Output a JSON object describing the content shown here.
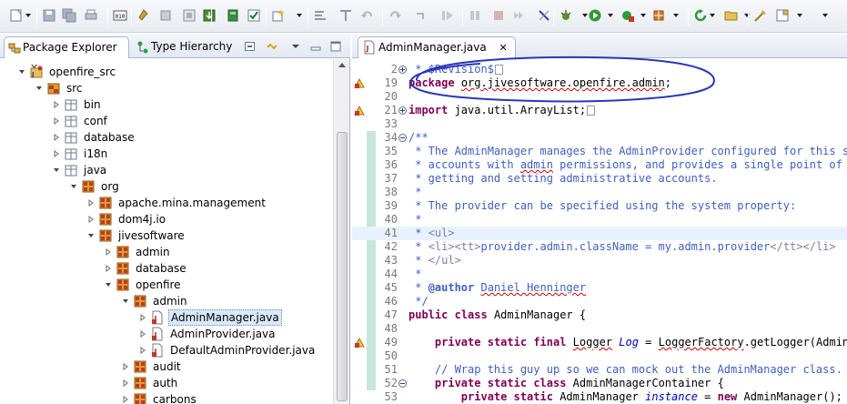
{
  "toolbar": {
    "icons": [
      "new-icon",
      "save-icon",
      "save-all-icon",
      "print-icon",
      "binary-icon",
      "pin-icon",
      "stop-icon",
      "console-icon",
      "download-icon",
      "battery-icon",
      "check-icon",
      "new-class-icon",
      "refactor-icon",
      "format-icon",
      "undo-icon",
      "redo-icon",
      "redo2-icon",
      "resume-icon",
      "suspend-icon",
      "terminate-icon",
      "step-icon",
      "skip-icon",
      "debug-icon",
      "run-icon",
      "run-config-icon",
      "build-icon",
      "refresh-icon",
      "open-folder-icon",
      "tools-icon",
      "perspective-icon"
    ]
  },
  "left_tabs": [
    {
      "label": "Package Explorer",
      "close": "✕"
    },
    {
      "label": "Type Hierarchy"
    }
  ],
  "tree": [
    {
      "label": "openfire_src",
      "depth": 0,
      "expanded": true,
      "icon": "project-icon"
    },
    {
      "label": "src",
      "depth": 1,
      "expanded": true,
      "icon": "source-folder-icon"
    },
    {
      "label": "bin",
      "depth": 2,
      "expanded": false,
      "icon": "folder-icon"
    },
    {
      "label": "conf",
      "depth": 2,
      "expanded": false,
      "icon": "folder-icon"
    },
    {
      "label": "database",
      "depth": 2,
      "expanded": false,
      "icon": "folder-icon"
    },
    {
      "label": "i18n",
      "depth": 2,
      "expanded": false,
      "icon": "folder-icon"
    },
    {
      "label": "java",
      "depth": 2,
      "expanded": true,
      "icon": "folder-icon"
    },
    {
      "label": "org",
      "depth": 3,
      "expanded": true,
      "icon": "package-icon"
    },
    {
      "label": "apache.mina.management",
      "depth": 4,
      "expanded": false,
      "icon": "package-icon"
    },
    {
      "label": "dom4j.io",
      "depth": 4,
      "expanded": false,
      "icon": "package-icon"
    },
    {
      "label": "jivesoftware",
      "depth": 4,
      "expanded": true,
      "icon": "package-icon"
    },
    {
      "label": "admin",
      "depth": 5,
      "expanded": false,
      "icon": "package-icon"
    },
    {
      "label": "database",
      "depth": 5,
      "expanded": false,
      "icon": "package-icon"
    },
    {
      "label": "openfire",
      "depth": 5,
      "expanded": true,
      "icon": "package-icon"
    },
    {
      "label": "admin",
      "depth": 6,
      "expanded": true,
      "icon": "package-icon"
    },
    {
      "label": "AdminManager.java",
      "depth": 7,
      "expanded": false,
      "icon": "java-file-icon",
      "selected": true
    },
    {
      "label": "AdminProvider.java",
      "depth": 7,
      "expanded": false,
      "icon": "java-file-icon"
    },
    {
      "label": "DefaultAdminProvider.java",
      "depth": 7,
      "expanded": false,
      "icon": "java-file-icon"
    },
    {
      "label": "audit",
      "depth": 6,
      "expanded": false,
      "icon": "package-icon"
    },
    {
      "label": "auth",
      "depth": 6,
      "expanded": false,
      "icon": "package-icon"
    },
    {
      "label": "carbons",
      "depth": 6,
      "expanded": false,
      "icon": "package-icon"
    }
  ],
  "editor": {
    "tab_label": "AdminManager.java",
    "tab_close": "✕",
    "lines": [
      {
        "num": "2",
        "fold": "plus",
        "marker": "",
        "segs": [
          [
            " * $Revision$",
            "cm"
          ],
          [
            "",
            "box"
          ]
        ]
      },
      {
        "num": "19",
        "fold": "",
        "marker": "warn",
        "segs": [
          [
            "package",
            "kw"
          ],
          [
            " ",
            ""
          ],
          [
            "org.jivesoftware.openfire.admin",
            "sq"
          ],
          [
            ";",
            ""
          ]
        ]
      },
      {
        "num": "20",
        "fold": "",
        "marker": "",
        "segs": []
      },
      {
        "num": "21",
        "fold": "plus",
        "marker": "warn",
        "segs": [
          [
            "import",
            "kw"
          ],
          [
            " java.util.ArrayList;",
            ""
          ],
          [
            "",
            "box"
          ]
        ]
      },
      {
        "num": "33",
        "fold": "",
        "marker": "",
        "segs": []
      },
      {
        "num": "34",
        "fold": "minus",
        "marker": "",
        "segs": [
          [
            "/**",
            "cm"
          ]
        ]
      },
      {
        "num": "35",
        "fold": "",
        "marker": "",
        "segs": [
          [
            " * The AdminManager manages the AdminProvider configured for this server, and provides",
            "cm"
          ]
        ]
      },
      {
        "num": "36",
        "fold": "",
        "marker": "",
        "segs": [
          [
            " * accounts with ",
            "cm"
          ],
          [
            "admin",
            "cm sq"
          ],
          [
            " permissions, and provides a single point of entry for",
            "cm"
          ]
        ]
      },
      {
        "num": "37",
        "fold": "",
        "marker": "",
        "segs": [
          [
            " * getting and setting administrative accounts.",
            "cm"
          ]
        ]
      },
      {
        "num": "38",
        "fold": "",
        "marker": "",
        "segs": [
          [
            " *",
            "cm"
          ]
        ]
      },
      {
        "num": "39",
        "fold": "",
        "marker": "",
        "segs": [
          [
            " * The provider can be specified using the system property:",
            "cm"
          ]
        ]
      },
      {
        "num": "40",
        "fold": "",
        "marker": "",
        "segs": [
          [
            " *",
            "cm"
          ]
        ]
      },
      {
        "num": "41",
        "fold": "",
        "marker": "",
        "cur": true,
        "segs": [
          [
            " * ",
            "cm"
          ],
          [
            "<ul>",
            "tg"
          ]
        ]
      },
      {
        "num": "42",
        "fold": "",
        "marker": "",
        "segs": [
          [
            " * ",
            "cm"
          ],
          [
            "<li><tt>",
            "tg"
          ],
          [
            "provider.admin.className = my.admin.provider",
            "cm"
          ],
          [
            "</tt></li>",
            "tg"
          ]
        ]
      },
      {
        "num": "43",
        "fold": "",
        "marker": "",
        "segs": [
          [
            " * ",
            "cm"
          ],
          [
            "</ul>",
            "tg"
          ]
        ]
      },
      {
        "num": "44",
        "fold": "",
        "marker": "",
        "segs": [
          [
            " *",
            "cm"
          ]
        ]
      },
      {
        "num": "45",
        "fold": "",
        "marker": "",
        "segs": [
          [
            " * ",
            "cm"
          ],
          [
            "@author",
            "cl"
          ],
          [
            " ",
            "cm"
          ],
          [
            "Daniel Henninger",
            "cm sq"
          ]
        ]
      },
      {
        "num": "46",
        "fold": "",
        "marker": "",
        "segs": [
          [
            " */",
            "cm"
          ]
        ]
      },
      {
        "num": "47",
        "fold": "",
        "marker": "",
        "segs": [
          [
            "public",
            "kw"
          ],
          [
            " ",
            ""
          ],
          [
            "class",
            "kw"
          ],
          [
            " AdminManager {",
            ""
          ]
        ]
      },
      {
        "num": "48",
        "fold": "",
        "marker": "",
        "segs": []
      },
      {
        "num": "49",
        "fold": "",
        "marker": "warn",
        "segs": [
          [
            "    ",
            ""
          ],
          [
            "private",
            "kw"
          ],
          [
            " ",
            ""
          ],
          [
            "static",
            "kw"
          ],
          [
            " ",
            ""
          ],
          [
            "final",
            "kw"
          ],
          [
            " ",
            ""
          ],
          [
            "Logger",
            "sq"
          ],
          [
            " ",
            ""
          ],
          [
            "Log",
            "fld"
          ],
          [
            " = ",
            ""
          ],
          [
            "LoggerFactory",
            "sq"
          ],
          [
            ".getLogger(AdminManager.class);",
            ""
          ]
        ]
      },
      {
        "num": "50",
        "fold": "",
        "marker": "",
        "segs": []
      },
      {
        "num": "51",
        "fold": "",
        "marker": "",
        "segs": [
          [
            "    // Wrap this guy up so we can mock out the AdminManager class.",
            "cm"
          ]
        ]
      },
      {
        "num": "52",
        "fold": "minus",
        "marker": "",
        "segs": [
          [
            "    ",
            ""
          ],
          [
            "private",
            "kw"
          ],
          [
            " ",
            ""
          ],
          [
            "static",
            "kw"
          ],
          [
            " ",
            ""
          ],
          [
            "class",
            "kw"
          ],
          [
            " AdminManagerContainer {",
            ""
          ]
        ]
      },
      {
        "num": "53",
        "fold": "",
        "marker": "",
        "segs": [
          [
            "        ",
            ""
          ],
          [
            "private",
            "kw"
          ],
          [
            " ",
            ""
          ],
          [
            "static",
            "kw"
          ],
          [
            " AdminManager ",
            ""
          ],
          [
            "instance",
            "fld"
          ],
          [
            " = ",
            ""
          ],
          [
            "new",
            "kw"
          ],
          [
            " AdminManager();",
            ""
          ]
        ]
      }
    ]
  },
  "colors": {
    "annotation": "#2a36b8",
    "keyword": "#7f0055",
    "comment": "#3f5fbf",
    "selection": "#dbe8fb"
  }
}
